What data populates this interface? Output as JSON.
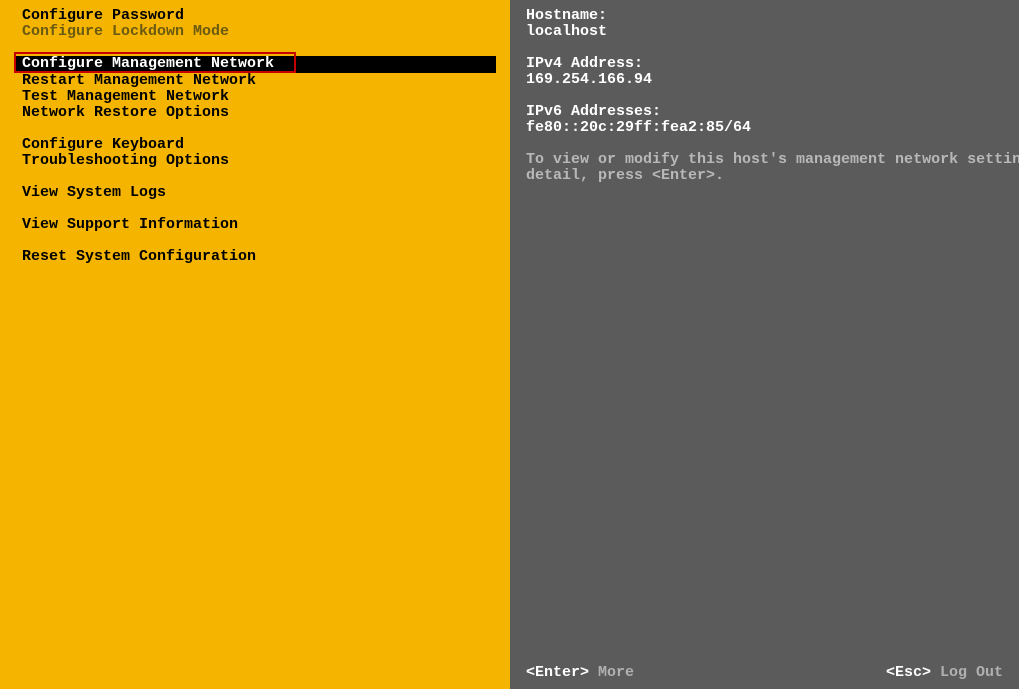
{
  "left": {
    "items": [
      {
        "label": "Configure Password",
        "state": "normal"
      },
      {
        "label": "Configure Lockdown Mode",
        "state": "disabled"
      },
      {
        "label": "",
        "state": "blank"
      },
      {
        "label": "Configure Management Network",
        "state": "selected"
      },
      {
        "label": "Restart Management Network",
        "state": "normal"
      },
      {
        "label": "Test Management Network",
        "state": "normal"
      },
      {
        "label": "Network Restore Options",
        "state": "normal"
      },
      {
        "label": "",
        "state": "blank"
      },
      {
        "label": "Configure Keyboard",
        "state": "normal"
      },
      {
        "label": "Troubleshooting Options",
        "state": "normal"
      },
      {
        "label": "",
        "state": "blank"
      },
      {
        "label": "View System Logs",
        "state": "normal"
      },
      {
        "label": "",
        "state": "blank"
      },
      {
        "label": "View Support Information",
        "state": "normal"
      },
      {
        "label": "",
        "state": "blank"
      },
      {
        "label": "Reset System Configuration",
        "state": "normal"
      }
    ]
  },
  "right": {
    "hostname_label": "Hostname:",
    "hostname_value": "localhost",
    "ipv4_label": "IPv4 Address:",
    "ipv4_value": "169.254.166.94",
    "ipv6_label": "IPv6 Addresses:",
    "ipv6_value": "fe80::20c:29ff:fea2:85/64",
    "help_line1": "To view or modify this host's management network settings in",
    "help_line2": "detail, press <Enter>."
  },
  "footer": {
    "enter_key": "<Enter>",
    "enter_hint": " More",
    "esc_key": "<Esc>",
    "esc_hint": " Log Out"
  }
}
